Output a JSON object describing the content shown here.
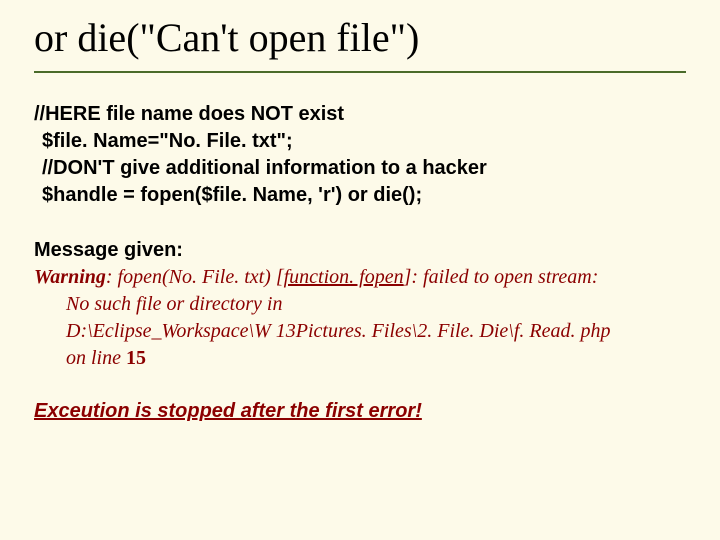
{
  "title": "or die(\"Can't open file\")",
  "code": {
    "c1": "//HERE file name does NOT exist",
    "c2": "$file. Name=\"No. File. txt\";",
    "c3": "//DON'T give additional information to a hacker",
    "c4": "$handle = fopen($file. Name, 'r') or die();"
  },
  "message": {
    "label": "Message given:",
    "warn": "Warning",
    "warn_after": ": fopen(No. File. txt) [",
    "link": "function. fopen",
    "after_link": "]: failed to open stream:",
    "line2": "No such file or directory in",
    "line3": "D:\\Eclipse_Workspace\\W 13Pictures. Files\\2. File. Die\\f. Read. php",
    "line4_pre": "on line ",
    "line4_num": "15"
  },
  "stop": "Exceution is stopped after the first error!"
}
